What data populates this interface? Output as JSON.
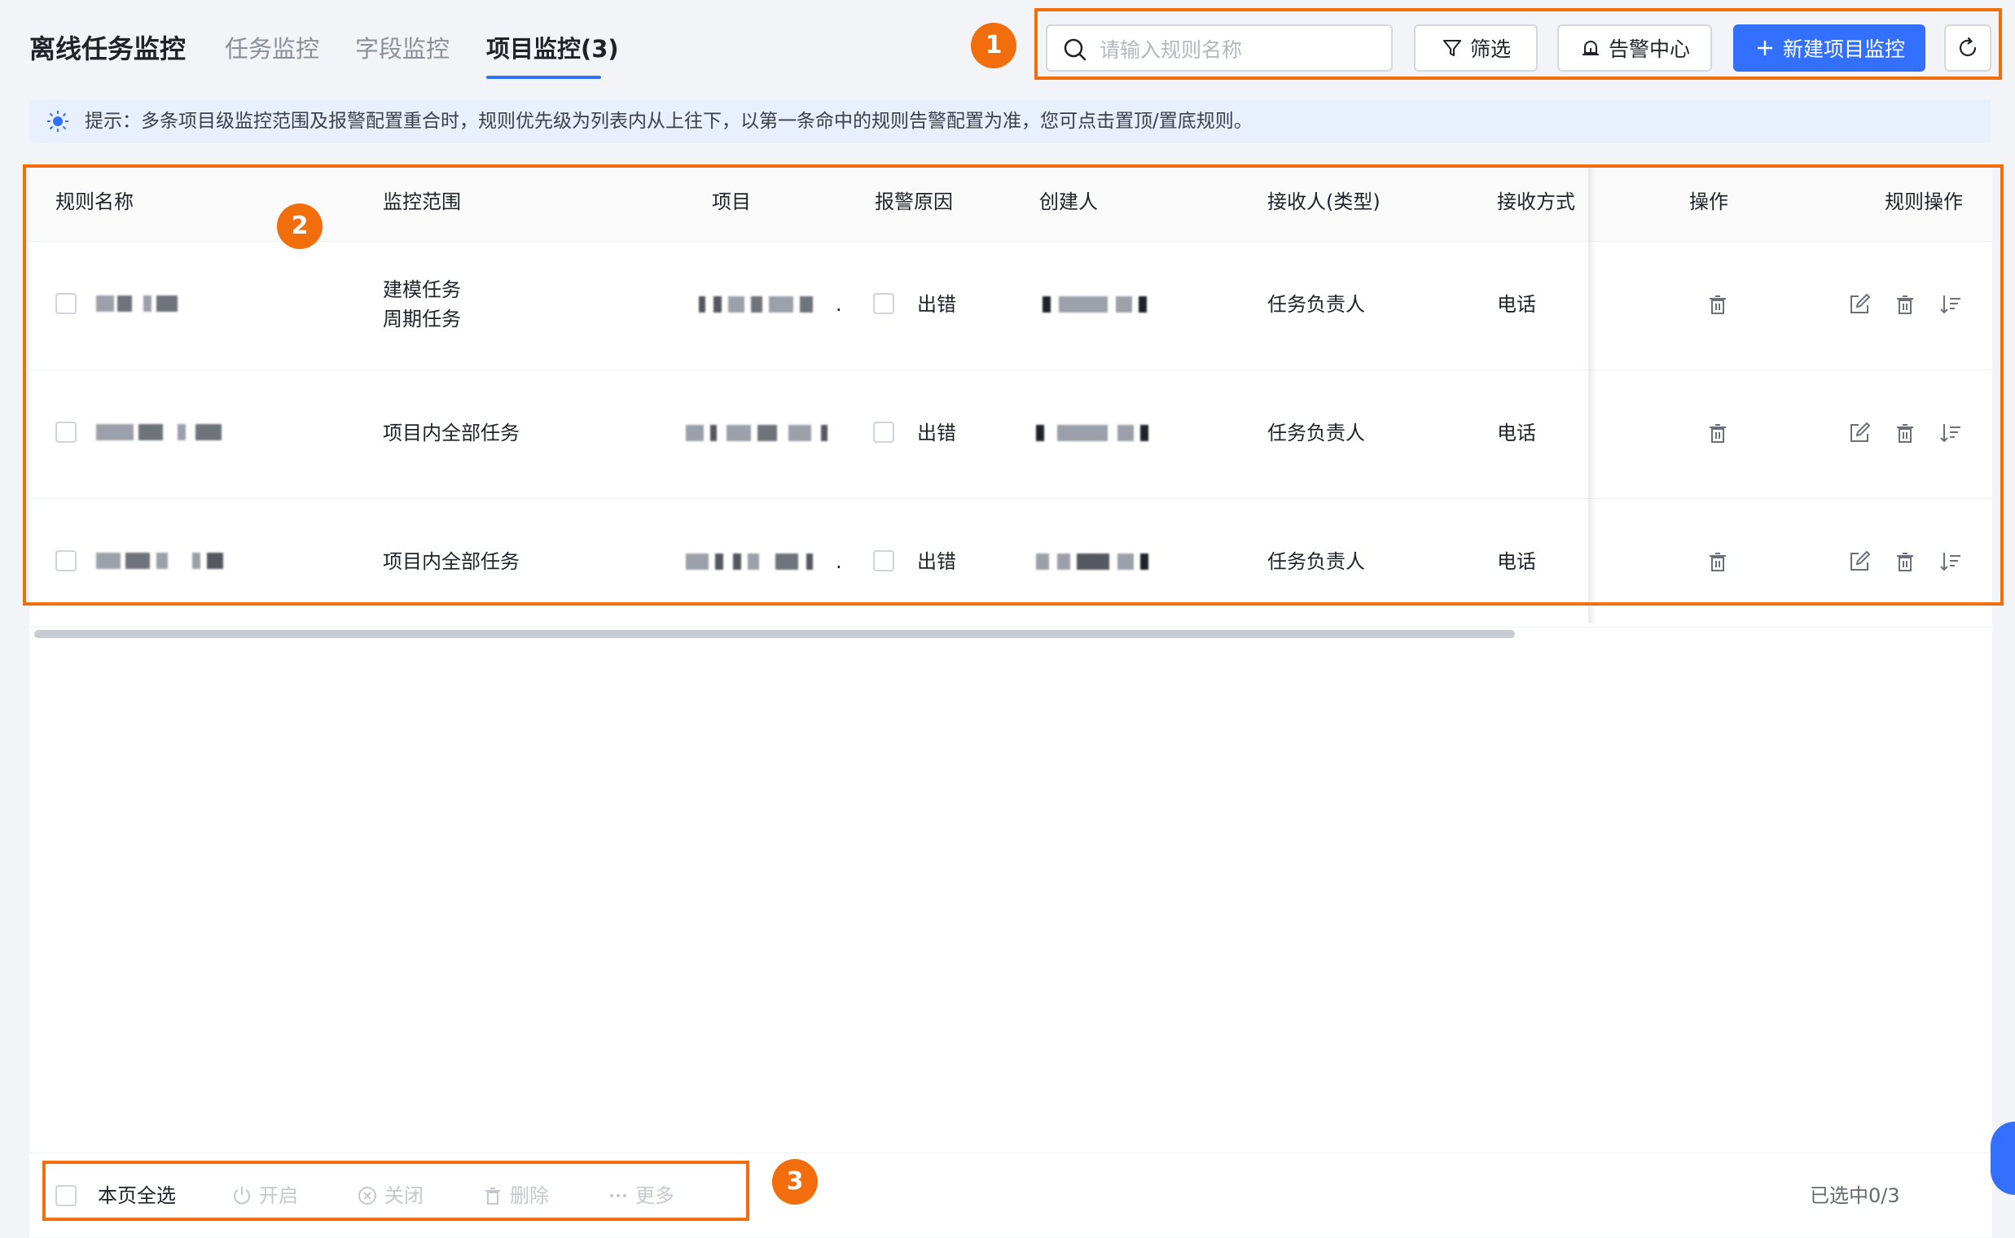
{
  "header": {
    "title": "离线任务监控",
    "tabs": [
      {
        "label": "任务监控",
        "active": false
      },
      {
        "label": "字段监控",
        "active": false
      },
      {
        "label": "项目监控(3)",
        "active": true
      }
    ]
  },
  "toolbar": {
    "search_placeholder": "请输入规则名称",
    "filter_label": "筛选",
    "alert_center_label": "告警中心",
    "new_monitor_label": "新建项目监控"
  },
  "tip": {
    "text": "提示：多条项目级监控范围及报警配置重合时，规则优先级为列表内从上往下，以第一条命中的规则告警配置为准，您可点击置顶/置底规则。"
  },
  "table": {
    "columns": [
      "规则名称",
      "监控范围",
      "项目",
      "报警原因",
      "创建人",
      "接收人(类型)",
      "接收方式",
      "操作",
      "规则操作"
    ],
    "rows": [
      {
        "scope_lines": [
          "建模任务",
          "周期任务"
        ],
        "project_suffix": ".",
        "reason": "出错",
        "receiver": "任务负责人",
        "method": "电话"
      },
      {
        "scope_lines": [
          "项目内全部任务"
        ],
        "project_suffix": "",
        "reason": "出错",
        "receiver": "任务负责人",
        "method": "电话"
      },
      {
        "scope_lines": [
          "项目内全部任务"
        ],
        "project_suffix": ".",
        "reason": "出错",
        "receiver": "任务负责人",
        "method": "电话"
      }
    ]
  },
  "bottom_bar": {
    "select_all_label": "本页全选",
    "enable_label": "开启",
    "disable_label": "关闭",
    "delete_label": "删除",
    "more_label": "更多",
    "selection_status": "已选中0/3"
  },
  "annotations": [
    {
      "number": "1"
    },
    {
      "number": "2"
    },
    {
      "number": "3"
    }
  ],
  "colors": {
    "accent": "#3370ff",
    "annotation": "#f26d0b",
    "tip_background": "#e8f0fe"
  }
}
